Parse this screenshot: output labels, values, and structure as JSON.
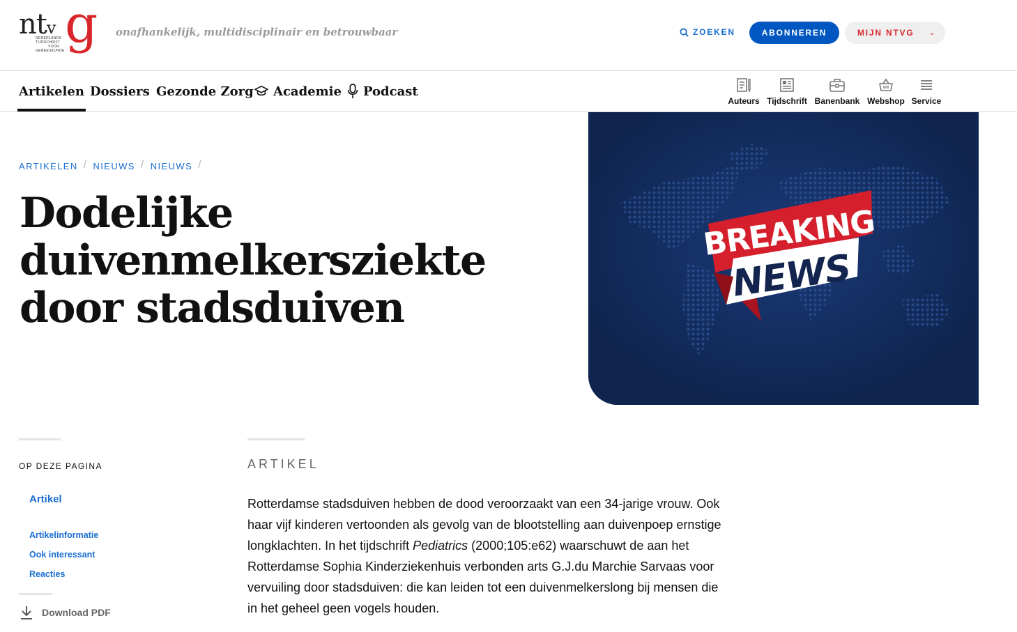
{
  "header": {
    "logo_text": "ntvg",
    "logo_subtitle": "NEDERLANDS TIJDSCHRIFT VOOR GENEESKUNDE",
    "tagline": "onafhankelijk, multidisciplinair en betrouwbaar",
    "search_label": "ZOEKEN",
    "subscribe_label": "ABONNEREN",
    "account_label": "MIJN NTVG"
  },
  "nav": {
    "items": [
      {
        "label": "Artikelen",
        "active": true
      },
      {
        "label": "Dossiers"
      },
      {
        "label": "Gezonde Zorg"
      },
      {
        "label": "Academie",
        "icon": "graduation-cap-icon"
      },
      {
        "label": "Podcast",
        "icon": "microphone-icon"
      }
    ],
    "utilities": [
      {
        "label": "Auteurs",
        "icon": "author-icon"
      },
      {
        "label": "Tijdschrift",
        "icon": "journal-icon"
      },
      {
        "label": "Banenbank",
        "icon": "briefcase-icon"
      },
      {
        "label": "Webshop",
        "icon": "basket-icon"
      },
      {
        "label": "Service",
        "icon": "menu-icon"
      }
    ]
  },
  "breadcrumb": [
    "ARTIKELEN",
    "NIEUWS",
    "NIEUWS"
  ],
  "article": {
    "title": "Dodelijke duivenmelkersziekte door stadsduiven",
    "section_label": "ARTIKEL",
    "body_part1": "Rotterdamse stadsduiven hebben de dood veroorzaakt van een 34-jarige vrouw. Ook haar vijf kinderen vertoonden als gevolg van de blootstelling aan duivenpoep ernstige longklachten. In het tijdschrift ",
    "body_journal": "Pediatrics",
    "body_part2": " (2000;105:e62) waarschuwt de aan het Rotterdamse Sophia Kinderziekenhuis verbonden arts G.J.du Marchie Sarvaas voor vervuiling door stadsduiven: die kan leiden tot een duivenmelkerslong bij mensen die in het geheel geen vogels houden."
  },
  "hero_image": {
    "line1": "BREAKING",
    "line2": "NEWS",
    "colors": {
      "background": "#0f2550",
      "banner_red": "#d61f2c",
      "banner_white": "#ffffff",
      "text_navy": "#13254f"
    }
  },
  "sidebar": {
    "title": "OP DEZE PAGINA",
    "main_link": "Artikel",
    "links": [
      "Artikelinformatie",
      "Ook interessant",
      "Reacties"
    ],
    "download_label": "Download PDF"
  },
  "colors": {
    "accent_blue": "#1a6fd0",
    "subscribe_blue": "#0057c2",
    "brand_red": "#d9262b"
  }
}
